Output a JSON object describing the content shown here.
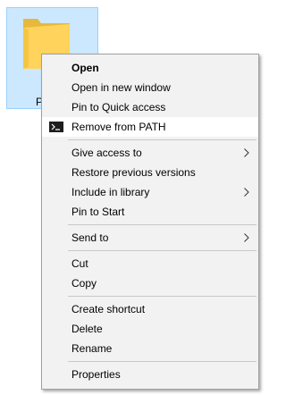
{
  "desktop": {
    "folder_label": "P",
    "folder_icon": "folder-icon"
  },
  "menu": {
    "groups": [
      [
        {
          "label": "Open",
          "bold": true
        },
        {
          "label": "Open in new window"
        },
        {
          "label": "Pin to Quick access"
        },
        {
          "label": "Remove from PATH",
          "icon": "terminal-icon",
          "highlighted": true
        }
      ],
      [
        {
          "label": "Give access to",
          "submenu": true
        },
        {
          "label": "Restore previous versions"
        },
        {
          "label": "Include in library",
          "submenu": true
        },
        {
          "label": "Pin to Start"
        }
      ],
      [
        {
          "label": "Send to",
          "submenu": true
        }
      ],
      [
        {
          "label": "Cut"
        },
        {
          "label": "Copy"
        }
      ],
      [
        {
          "label": "Create shortcut"
        },
        {
          "label": "Delete"
        },
        {
          "label": "Rename"
        }
      ],
      [
        {
          "label": "Properties"
        }
      ]
    ]
  },
  "colors": {
    "selection_fill": "#cce8ff",
    "selection_border": "#99d1ff",
    "menu_background": "#f2f2f2",
    "menu_highlight": "#ffffff",
    "folder_yellow": "#ffd35c"
  }
}
